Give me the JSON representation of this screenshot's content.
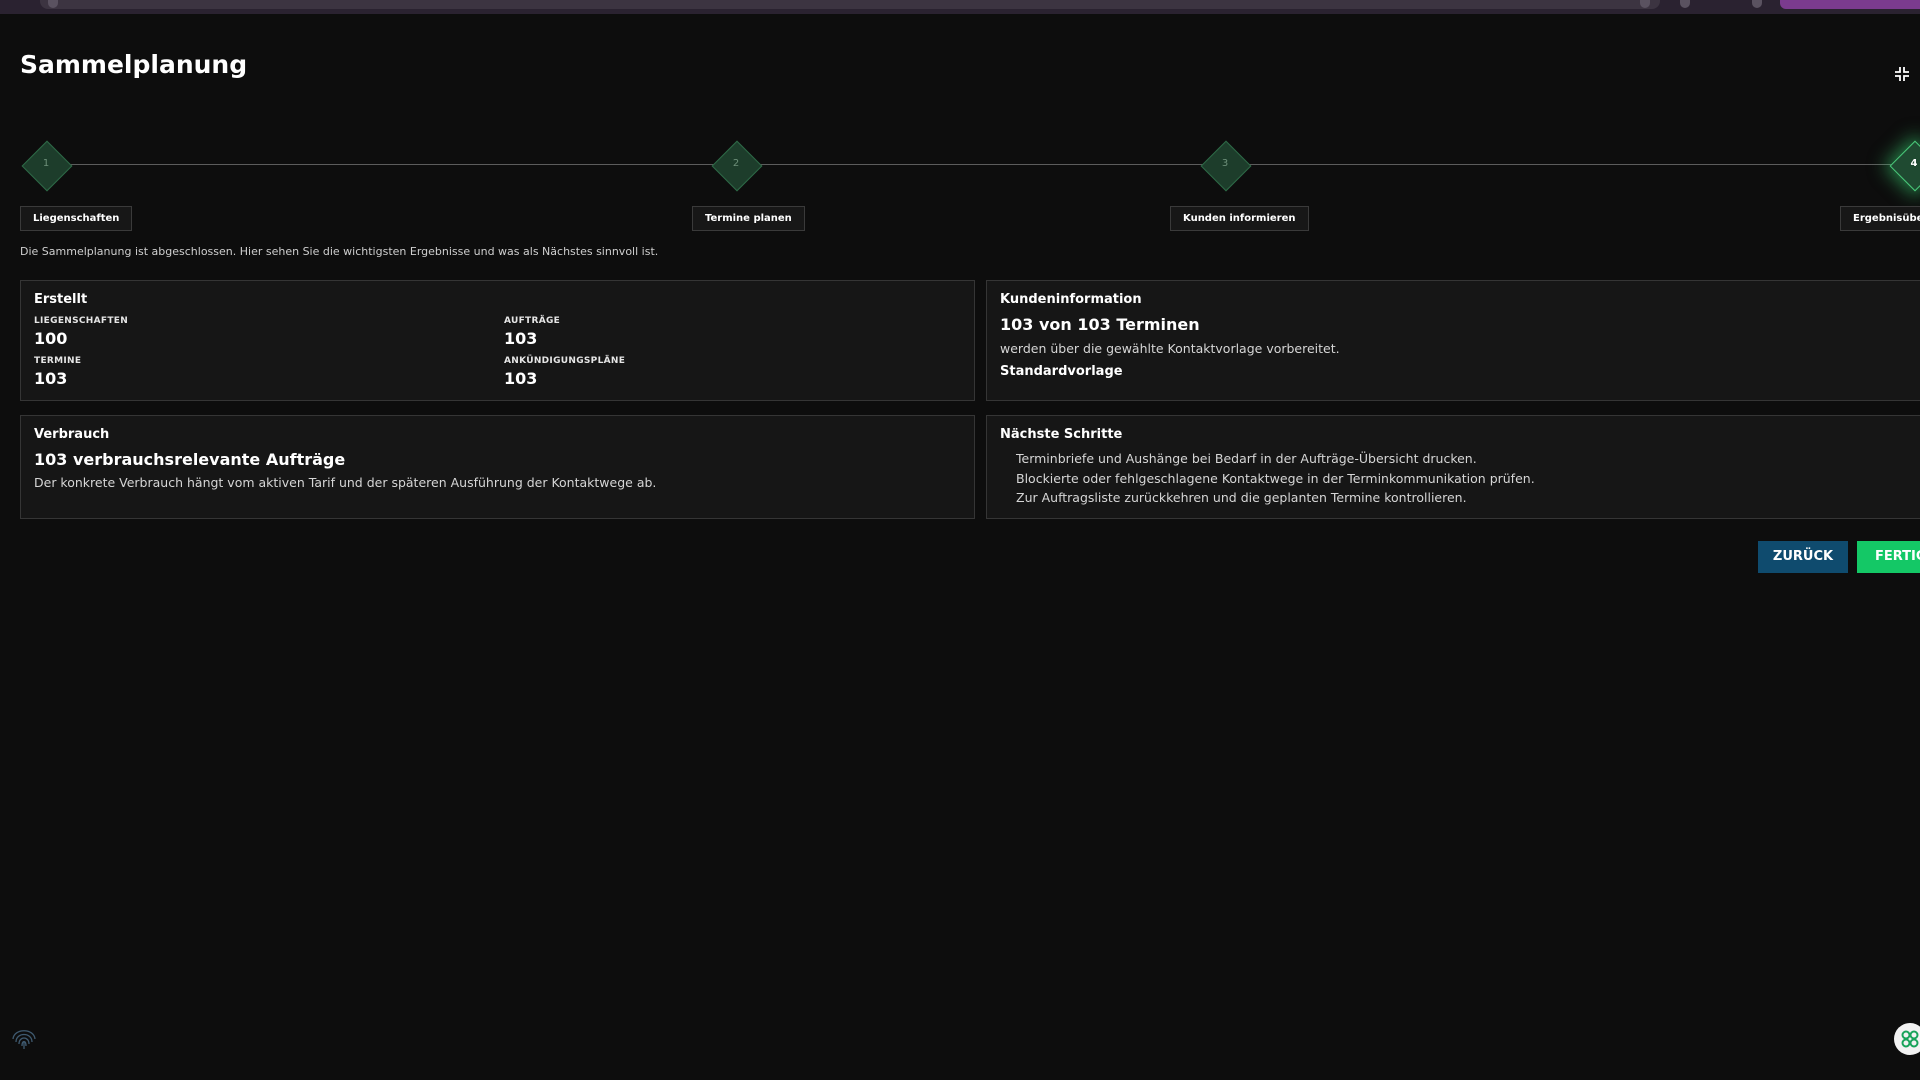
{
  "browser": {
    "icons": [
      "url-bar",
      "extension-badge"
    ]
  },
  "page": {
    "title": "Sammelplanung",
    "collapse_icon": "collapse-icon"
  },
  "stepper": {
    "steps": [
      {
        "number": "1",
        "label": "Liegenschaften",
        "state": "done"
      },
      {
        "number": "2",
        "label": "Termine planen",
        "state": "done"
      },
      {
        "number": "3",
        "label": "Kunden informieren",
        "state": "done"
      },
      {
        "number": "4",
        "label": "Ergebnisübersicht",
        "state": "active"
      }
    ]
  },
  "intro": "Die Sammelplanung ist abgeschlossen. Hier sehen Sie die wichtigsten Ergebnisse und was als Nächstes sinnvoll ist.",
  "created": {
    "title": "Erstellt",
    "items": [
      {
        "label": "LIEGENSCHAFTEN",
        "value": "100"
      },
      {
        "label": "AUFTRÄGE",
        "value": "103"
      },
      {
        "label": "TERMINE",
        "value": "103"
      },
      {
        "label": "ANKÜNDIGUNGSPLÄNE",
        "value": "103"
      }
    ]
  },
  "customer_info": {
    "title": "Kundeninformation",
    "headline": "103 von 103 Terminen",
    "text": "werden über die gewählte Kontaktvorlage vorbereitet.",
    "template": "Standardvorlage"
  },
  "consumption": {
    "title": "Verbrauch",
    "headline": "103 verbrauchsrelevante Aufträge",
    "text": "Der konkrete Verbrauch hängt vom aktiven Tarif und der späteren Ausführung der Kontaktwege ab."
  },
  "next_steps": {
    "title": "Nächste Schritte",
    "items": [
      "Terminbriefe und Aushänge bei Bedarf in der Aufträge-Übersicht drucken.",
      "Blockierte oder fehlgeschlagene Kontaktwege in der Terminkommunikation prüfen.",
      "Zur Auftragsliste zurückkehren und die geplanten Termine kontrollieren."
    ]
  },
  "actions": {
    "back": "ZURÜCK",
    "done": "FERTIG"
  },
  "colors": {
    "background": "#0d0d0d",
    "card": "#161616",
    "accent_green": "#14c866",
    "back_button": "#0f4b6e",
    "step_diamond": "#1d3d2b"
  },
  "widgets": {
    "fingerprint": "fingerprint-icon",
    "help": "help-widget-icon"
  }
}
